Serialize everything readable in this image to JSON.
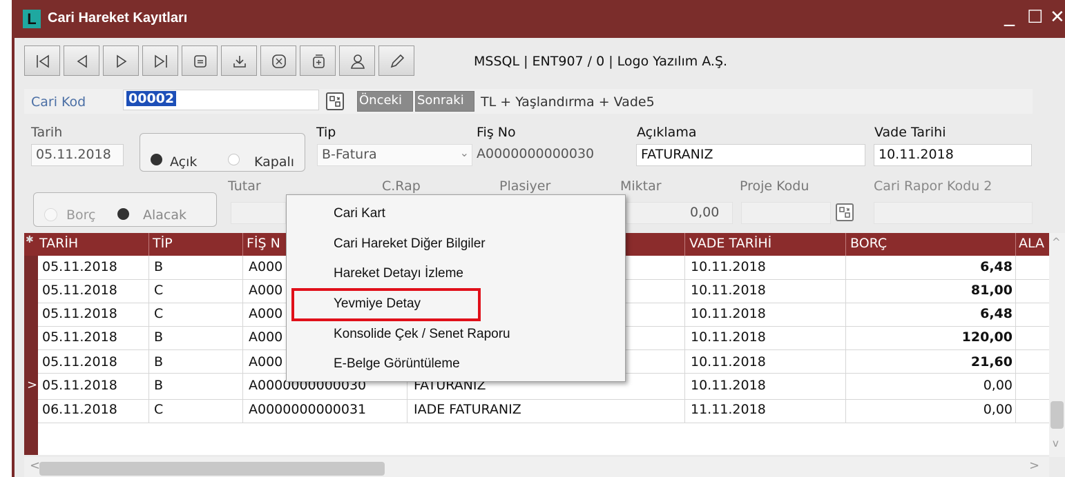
{
  "window": {
    "title": "Cari Hareket Kayıtları",
    "logo_letter": "L",
    "controls": [
      "_",
      "☐",
      "✕"
    ]
  },
  "toolbar": {
    "buttons": [
      "first-record-icon",
      "previous-record-icon",
      "next-record-icon",
      "last-record-icon",
      "list-icon",
      "save-icon",
      "cancel-icon",
      "new-copy-icon",
      "user-icon",
      "edit-pencil-icon"
    ],
    "connection_info": "MSSQL | ENT907 / 0 | Logo Yazılım A.Ş."
  },
  "form": {
    "cari_kod_label": "Cari Kod",
    "cari_kod_value": "00002",
    "onceki_label": "Önceki",
    "sonraki_label": "Sonraki",
    "cari_desc": "TL + Yaşlandırma + Vade5",
    "tarih_label": "Tarih",
    "tarih_value": "05.11.2018",
    "acik_label": "Açık",
    "kapali_label": "Kapalı",
    "tip_label": "Tip",
    "tip_value": "B-Fatura",
    "fis_no_label": "Fiş No",
    "fis_no_value": "A0000000000030",
    "aciklama_label": "Açıklama",
    "aciklama_value": "FATURANIZ",
    "vade_tarihi_label": "Vade Tarihi",
    "vade_tarihi_value": "10.11.2018",
    "borc_label": "Borç",
    "alacak_label": "Alacak",
    "tutar_label": "Tutar",
    "crap_label": "C.Rap",
    "plasiyer_label": "Plasiyer",
    "miktar_label": "Miktar",
    "miktar_value": "0,00",
    "proje_kodu_label": "Proje Kodu",
    "cari_rapor_kodu2_label": "Cari Rapor Kodu 2"
  },
  "grid": {
    "columns": [
      "TARİH",
      "TİP",
      "FİŞ N",
      "VADE TARİHİ",
      "BORÇ",
      "ALA"
    ],
    "rows": [
      {
        "tarih": "05.11.2018",
        "tip": "B",
        "fis": "A000",
        "aciklama": "",
        "vade": "10.11.2018",
        "borc": "6,48"
      },
      {
        "tarih": "05.11.2018",
        "tip": "C",
        "fis": "A000",
        "aciklama": "",
        "vade": "10.11.2018",
        "borc": "81,00"
      },
      {
        "tarih": "05.11.2018",
        "tip": "C",
        "fis": "A000",
        "aciklama": "",
        "vade": "10.11.2018",
        "borc": "6,48"
      },
      {
        "tarih": "05.11.2018",
        "tip": "B",
        "fis": "A000",
        "aciklama": "",
        "vade": "10.11.2018",
        "borc": "120,00"
      },
      {
        "tarih": "05.11.2018",
        "tip": "B",
        "fis": "A000",
        "aciklama": "",
        "vade": "10.11.2018",
        "borc": "21,60"
      },
      {
        "tarih": "05.11.2018",
        "tip": "B",
        "fis": "A0000000000030",
        "aciklama": "FATURANIZ",
        "vade": "10.11.2018",
        "borc": "0,00"
      },
      {
        "tarih": "06.11.2018",
        "tip": "C",
        "fis": "A0000000000031",
        "aciklama": "IADE FATURANIZ",
        "vade": "11.11.2018",
        "borc": "0,00"
      }
    ],
    "current_row_marker": ">"
  },
  "context_menu": {
    "items": [
      "Cari Kart",
      "Cari Hareket Diğer Bilgiler",
      "Hareket Detayı İzleme",
      "Yevmiye Detay",
      "Konsolide Çek / Senet Raporu",
      "E-Belge Görüntüleme"
    ],
    "highlighted": "Yevmiye Detay"
  },
  "scroll": {
    "left_arrow": "<",
    "right_arrow": ">",
    "up_arrow": "^",
    "down_arrow": "v"
  }
}
